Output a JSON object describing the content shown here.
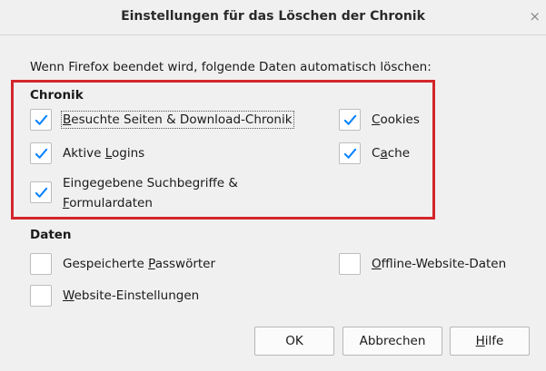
{
  "dialog": {
    "title": "Einstellungen für das Löschen der Chronik",
    "close_icon": "×",
    "intro": "Wenn Firefox beendet wird, folgende Daten automatisch löschen:"
  },
  "chronik": {
    "heading": "Chronik",
    "items": [
      {
        "pre": "",
        "key": "B",
        "post": "esuchte Seiten & Download-Chronik",
        "checked": true
      },
      {
        "pre": "Aktive ",
        "key": "L",
        "post": "ogins",
        "checked": true
      },
      {
        "pre": "",
        "key": "C",
        "post": "ookies",
        "checked": true
      },
      {
        "pre": "C",
        "key": "a",
        "post": "che",
        "checked": true
      },
      {
        "line1": "Eingegebene Suchbegriffe &",
        "key": "F",
        "post": "ormulardaten",
        "checked": true
      }
    ]
  },
  "daten": {
    "heading": "Daten",
    "items": [
      {
        "pre": "Gespeicherte ",
        "key": "P",
        "post": "asswörter",
        "checked": false
      },
      {
        "pre": "",
        "key": "O",
        "post": "ffline-Website-Daten",
        "checked": false
      },
      {
        "pre": "",
        "key": "W",
        "post": "ebsite-Einstellungen",
        "checked": false
      }
    ]
  },
  "buttons": {
    "ok": "OK",
    "cancel": "Abbrechen",
    "help_key": "H",
    "help_post": "ilfe"
  },
  "colors": {
    "highlight_box": "#d3262b",
    "checkmark": "#0a84ff"
  }
}
